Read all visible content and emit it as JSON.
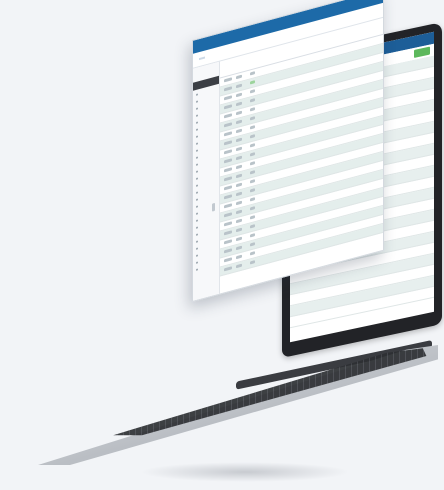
{
  "window": {
    "brand": "",
    "title": "",
    "page_title": "",
    "header_label": ""
  },
  "colors": {
    "header_bar": "#1d6aa8",
    "row_alt": "#e4eeec",
    "accent_green": "#5cb85c",
    "laptop_body": "#222327"
  },
  "laptop_screen": {
    "button_label": "",
    "label": ""
  }
}
